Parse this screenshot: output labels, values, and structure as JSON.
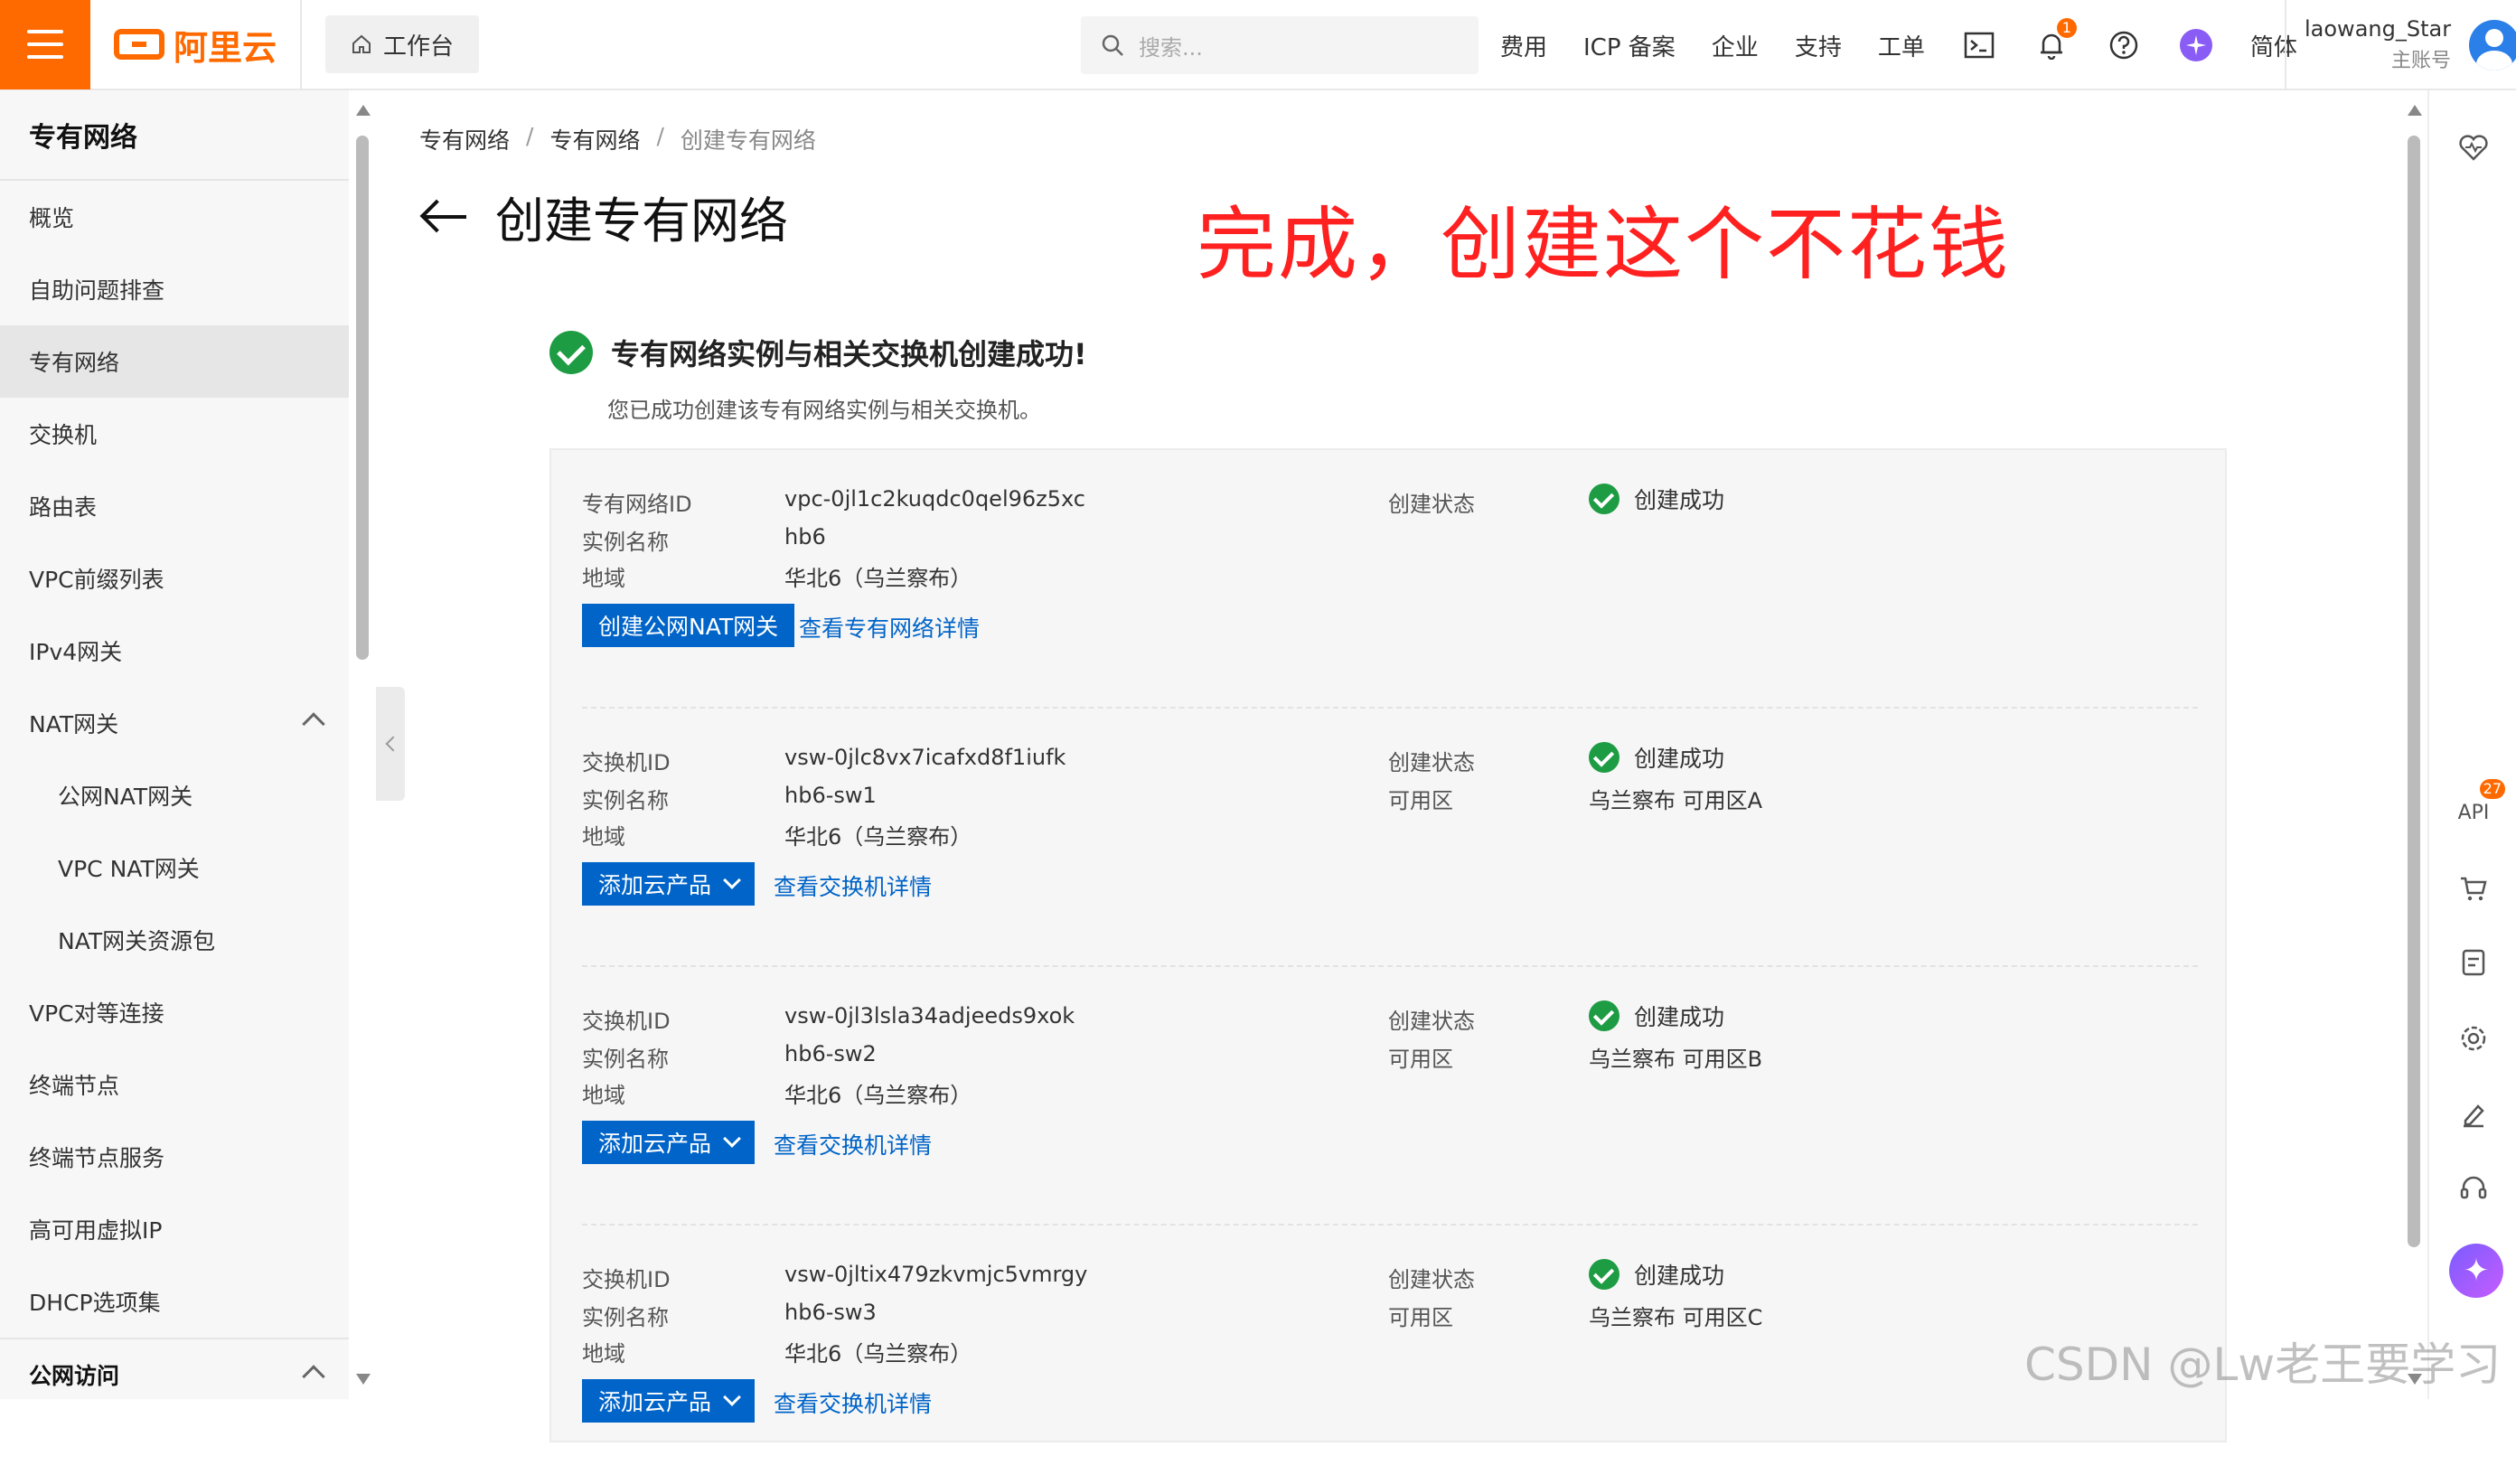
{
  "topbar": {
    "logo_text": "阿里云",
    "workbench": "工作台",
    "search_placeholder": "搜索...",
    "nav": [
      "费用",
      "ICP 备案",
      "企业",
      "支持",
      "工单"
    ],
    "notification_count": "1",
    "language": "简体",
    "username": "laowang_Star",
    "account_role": "主账号"
  },
  "sidebar": {
    "title": "专有网络",
    "items": [
      {
        "label": "概览"
      },
      {
        "label": "自助问题排查"
      },
      {
        "label": "专有网络"
      },
      {
        "label": "交换机"
      },
      {
        "label": "路由表"
      },
      {
        "label": "VPC前缀列表"
      },
      {
        "label": "IPv4网关"
      },
      {
        "label": "NAT网关"
      },
      {
        "label": "公网NAT网关"
      },
      {
        "label": "VPC NAT网关"
      },
      {
        "label": "NAT网关资源包"
      },
      {
        "label": "VPC对等连接"
      },
      {
        "label": "终端节点"
      },
      {
        "label": "终端节点服务"
      },
      {
        "label": "高可用虚拟IP"
      },
      {
        "label": "DHCP选项集"
      },
      {
        "label": "公网访问"
      }
    ]
  },
  "breadcrumb": [
    "专有网络",
    "专有网络",
    "创建专有网络"
  ],
  "page_title": "创建专有网络",
  "annotation": "完成，创建这个不花钱",
  "success": {
    "title": "专有网络实例与相关交换机创建成功!",
    "subtitle": "您已成功创建该专有网络实例与相关交换机。"
  },
  "labels": {
    "vpc_id": "专有网络ID",
    "vsw_id": "交换机ID",
    "name": "实例名称",
    "region": "地域",
    "status": "创建状态",
    "zone_label": "可用区",
    "status_value": "创建成功"
  },
  "vpc": {
    "id": "vpc-0jl1c2kuqdc0qel96z5xc",
    "name": "hb6",
    "region": "华北6（乌兰察布）",
    "btn": "创建公网NAT网关",
    "link": "查看专有网络详情"
  },
  "switches": [
    {
      "id": "vsw-0jlc8vx7icafxd8f1iufk",
      "name": "hb6-sw1",
      "region": "华北6（乌兰察布）",
      "zone": "乌兰察布 可用区A",
      "btn": "添加云产品",
      "link": "查看交换机详情"
    },
    {
      "id": "vsw-0jl3lsla34adjeeds9xok",
      "name": "hb6-sw2",
      "region": "华北6（乌兰察布）",
      "zone": "乌兰察布 可用区B",
      "btn": "添加云产品",
      "link": "查看交换机详情"
    },
    {
      "id": "vsw-0jltix479zkvmjc5vmrgy",
      "name": "hb6-sw3",
      "region": "华北6（乌兰察布）",
      "zone": "乌兰察布 可用区C",
      "btn": "添加云产品",
      "link": "查看交换机详情"
    }
  ],
  "rail": {
    "api_label": "API",
    "api_badge": "27"
  },
  "watermark": "CSDN @Lw老王要学习"
}
